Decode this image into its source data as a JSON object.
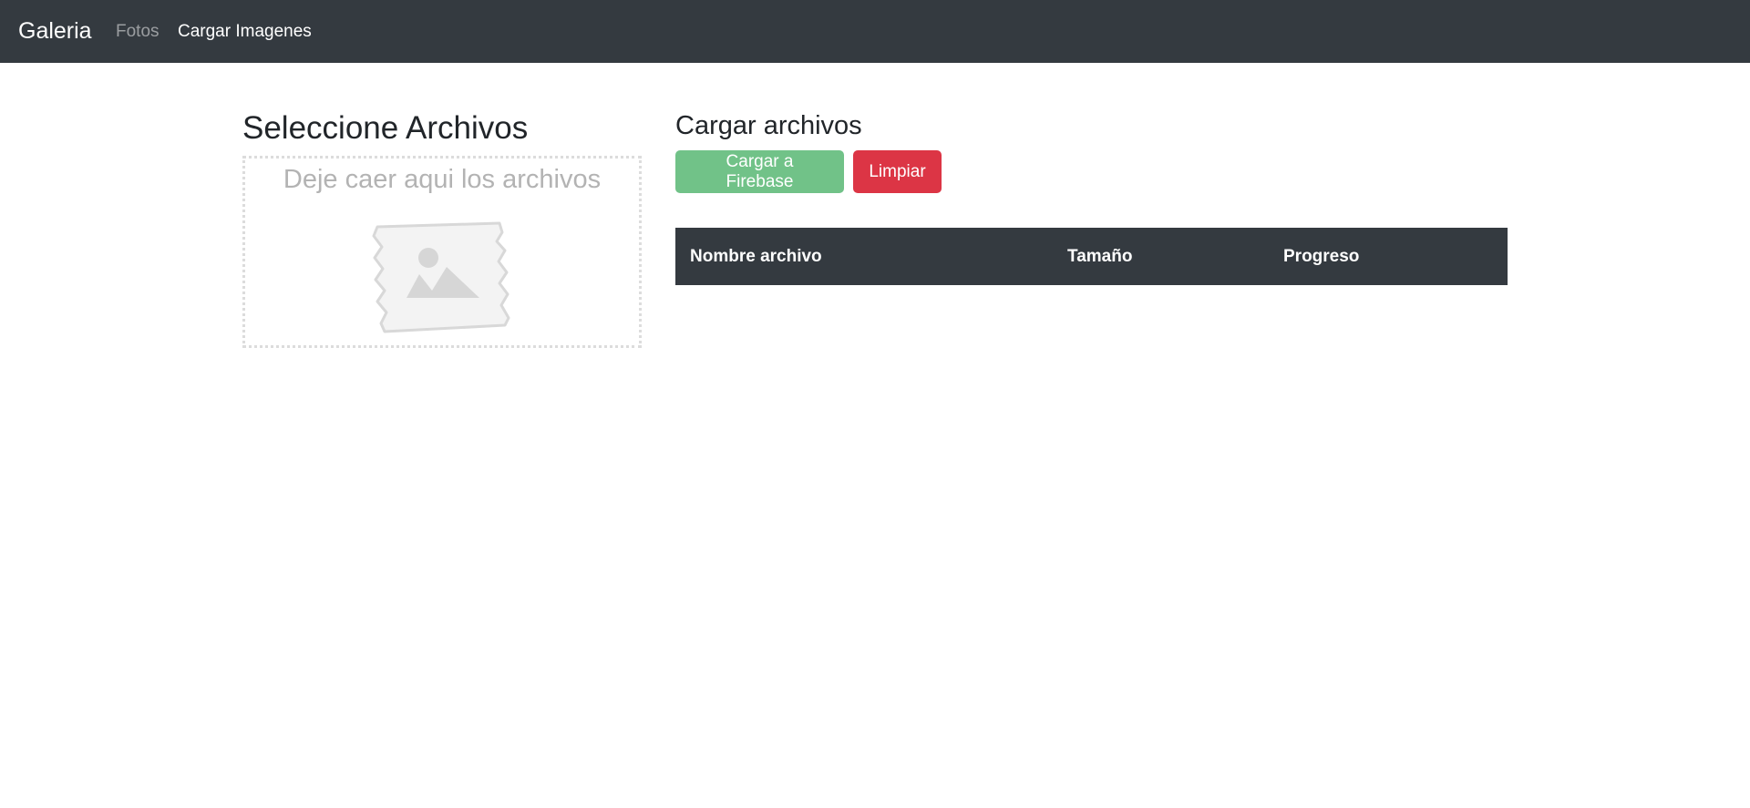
{
  "navbar": {
    "brand": "Galeria",
    "links": [
      {
        "label": "Fotos",
        "active": false
      },
      {
        "label": "Cargar Imagenes",
        "active": true
      }
    ],
    "background": "#343a40"
  },
  "left_panel": {
    "title": "Seleccione Archivos",
    "dropzone": {
      "text": "Deje caer aqui los archivos",
      "icon": "image-placeholder-icon"
    }
  },
  "right_panel": {
    "title": "Cargar archivos",
    "buttons": {
      "upload_label": "Cargar a Firebase",
      "upload_color": "#71c288",
      "clear_label": "Limpiar",
      "clear_color": "#dc3545"
    },
    "table": {
      "columns": [
        "Nombre archivo",
        "Tamaño",
        "Progreso"
      ],
      "rows": []
    }
  }
}
